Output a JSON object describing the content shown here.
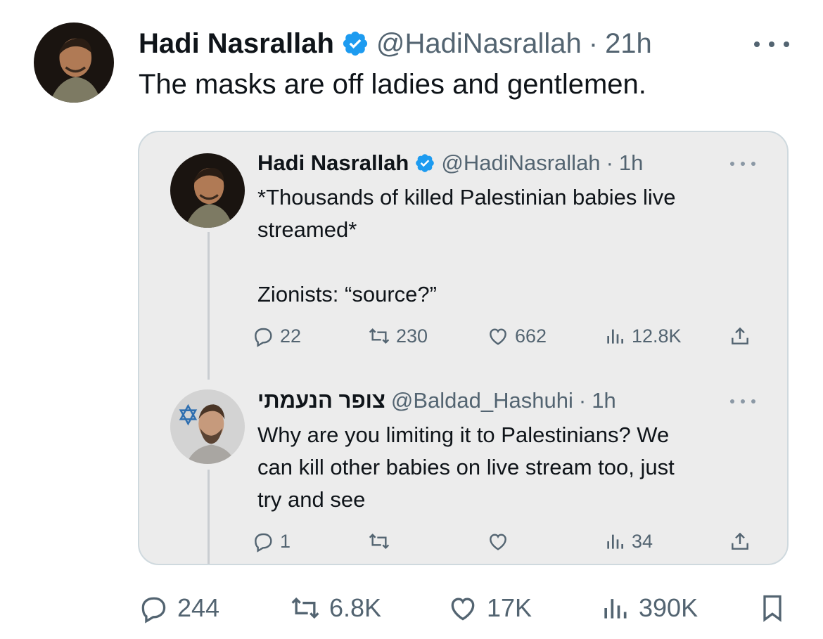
{
  "tweet": {
    "author_name": "Hadi Nasrallah",
    "handle": "@HadiNasrallah",
    "separator": "·",
    "time": "21h",
    "text": "The masks are off ladies and gentlemen.",
    "stats": {
      "replies": "244",
      "retweets": "6.8K",
      "likes": "17K",
      "views": "390K"
    }
  },
  "quote": {
    "first": {
      "author_name": "Hadi Nasrallah",
      "handle": "@HadiNasrallah",
      "time": "1h",
      "text": "*Thousands of killed Palestinian babies live\nstreamed*\n\nZionists: “source?”",
      "stats": {
        "replies": "22",
        "retweets": "230",
        "likes": "662",
        "views": "12.8K"
      }
    },
    "second": {
      "author_name": "צופר הנעמתי",
      "handle": "@Baldad_Hashuhi",
      "time": "1h",
      "text": "Why are you limiting it to Palestinians? We\ncan kill other babies on live stream too, just\ntry and see",
      "stats": {
        "replies": "1",
        "views": "34"
      }
    }
  },
  "icons": {
    "verified": "verified-badge-icon",
    "more": "more-dots-icon",
    "reply": "reply-icon",
    "retweet": "retweet-icon",
    "like": "like-heart-icon",
    "views": "views-chart-icon",
    "share": "share-icon",
    "bookmark": "bookmark-icon",
    "star_of_david": "star-of-david-icon"
  },
  "colors": {
    "accent_blue": "#1d9bf0",
    "secondary_text": "#536471",
    "card_bg": "#ececec",
    "card_border": "#cfd9de"
  }
}
